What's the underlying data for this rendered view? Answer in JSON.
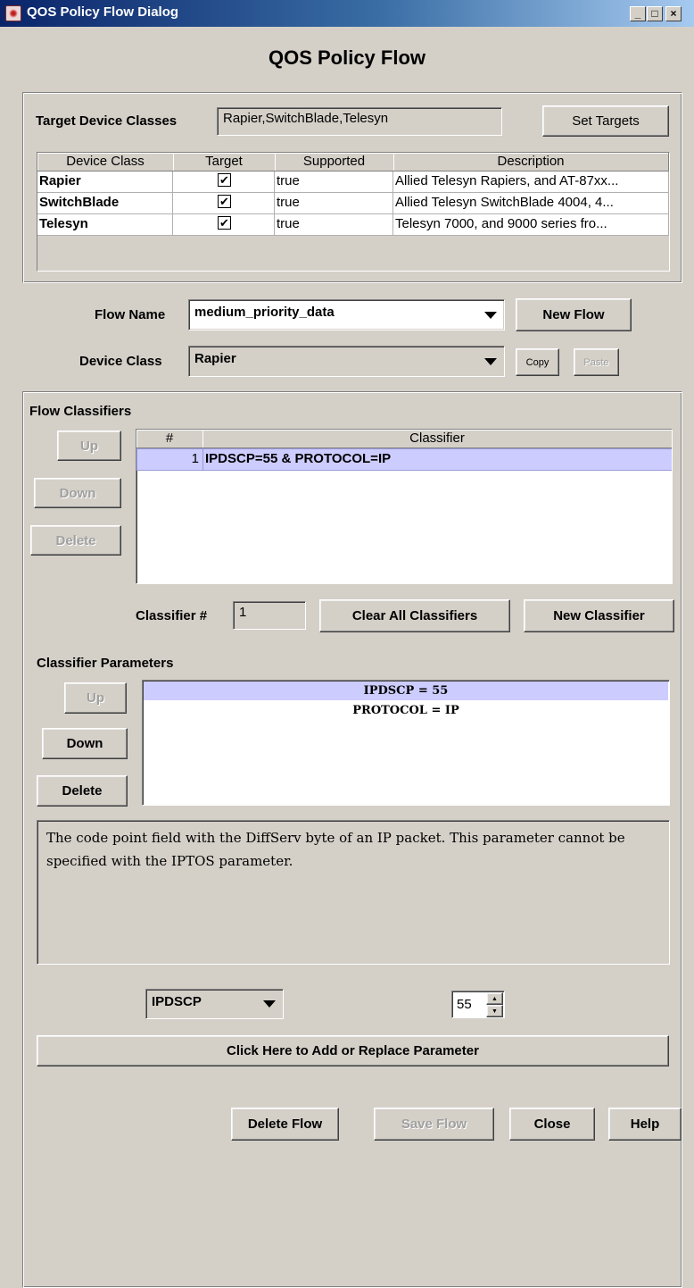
{
  "window": {
    "title": "QOS Policy Flow Dialog",
    "controls": [
      "_",
      "□",
      "×"
    ]
  },
  "heading": "QOS Policy Flow",
  "targets": {
    "label": "Target Device Classes",
    "value": "Rapier,SwitchBlade,Telesyn",
    "set_button": "Set Targets",
    "columns": [
      "Device Class",
      "Target",
      "Supported",
      "Description"
    ],
    "rows": [
      {
        "device_class": "Rapier",
        "target": true,
        "supported": "true",
        "description": "Allied Telesyn Rapiers, and AT-87xx..."
      },
      {
        "device_class": "SwitchBlade",
        "target": true,
        "supported": "true",
        "description": "Allied Telesyn SwitchBlade 4004, 4..."
      },
      {
        "device_class": "Telesyn",
        "target": true,
        "supported": "true",
        "description": "Telesyn 7000, and 9000 series fro..."
      }
    ]
  },
  "flow": {
    "name_label": "Flow Name",
    "name_value": "medium_priority_data",
    "new_flow_button": "New Flow",
    "device_class_label": "Device Class",
    "device_class_value": "Rapier",
    "copy_button": "Copy",
    "paste_button": "Paste"
  },
  "classifiers": {
    "section_label": "Flow Classifiers",
    "up_button": "Up",
    "down_button": "Down",
    "delete_button": "Delete",
    "columns": [
      "#",
      "Classifier"
    ],
    "rows": [
      {
        "num": "1",
        "classifier": "IPDSCP=55 & PROTOCOL=IP"
      }
    ],
    "classifier_num_label": "Classifier #",
    "classifier_num_value": "1",
    "clear_all_button": "Clear All Classifiers",
    "new_classifier_button": "New Classifier"
  },
  "parameters": {
    "section_label": "Classifier Parameters",
    "up_button": "Up",
    "down_button": "Down",
    "delete_button": "Delete",
    "items": [
      "IPDSCP = 55",
      "PROTOCOL = IP"
    ],
    "description": "The code point field with the DiffServ byte of an IP packet. This parameter cannot be specified with the IPTOS parameter.",
    "param_select": "IPDSCP",
    "param_value": "55",
    "add_button": "Click Here to Add or Replace Parameter"
  },
  "footer": {
    "delete_flow": "Delete Flow",
    "save_flow": "Save Flow",
    "close": "Close",
    "help": "Help"
  },
  "colors": {
    "titlebar_start": "#0a246a",
    "titlebar_end": "#a6caf0",
    "selection": "#ccccff",
    "window_bg": "#d4d0c8"
  }
}
